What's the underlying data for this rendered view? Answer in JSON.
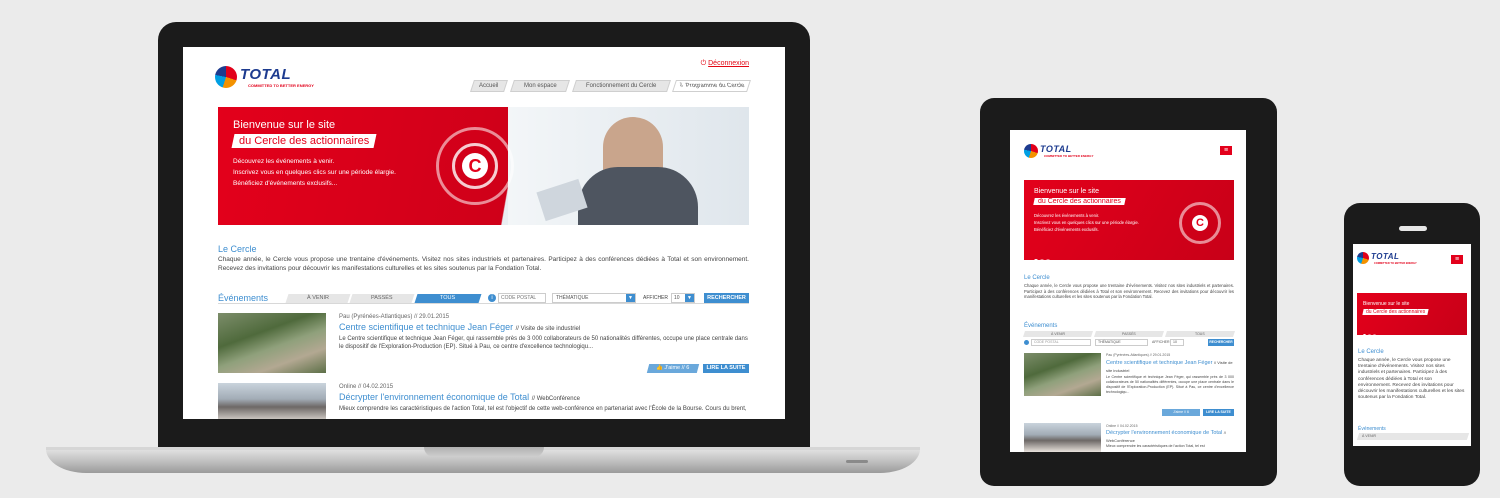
{
  "laptop": {
    "logout": "Déconnexion",
    "logo_word": "TOTAL",
    "logo_tag": "COMMITTED TO BETTER ENERGY",
    "nav": [
      {
        "label": "Accueil"
      },
      {
        "label": "Mon espace"
      },
      {
        "label": "Fonctionnement du Cercle"
      },
      {
        "label": "Programme du Cercle"
      }
    ],
    "banner": {
      "title1": "Bienvenue sur le site",
      "title2": "du Cercle des actionnaires",
      "line1": "Découvrez les événements à venir.",
      "line2": "Inscrivez vous en quelques clics sur une période élargie.",
      "line3": "Bénéficiez d'événements exclusifs..."
    },
    "intro": {
      "heading": "Le Cercle",
      "body": "Chaque année, le Cercle vous propose une trentaine d'événements. Visitez nos sites industriels et partenaires. Participez à des conférences dédiées à Total et son environnement. Recevez des invitations pour découvrir les manifestations culturelles et les sites soutenus par la Fondation Total."
    },
    "filters": {
      "heading": "Événements",
      "tabs": [
        "À VENIR",
        "PASSÉS",
        "TOUS"
      ],
      "postal_placeholder": "CODE POSTAL",
      "theme": "THÉMATIQUE",
      "show_label": "AFFICHER",
      "show_value": "10",
      "search": "RECHERCHER"
    },
    "events": [
      {
        "meta": "Pau (Pyrénées-Atlantiques) // 29.01.2015",
        "title": "Centre scientifique et technique Jean Féger",
        "type": "// Visite de site industriel",
        "desc": "Le Centre scientifique et technique Jean Féger, qui rassemble près de 3 000 collaborateurs de 50 nationalités différentes, occupe une place centrale dans le dispositif de l'Exploration-Production (EP). Situé à Pau, ce centre d'excellence technologiqu...",
        "likes": "J'aime // 6",
        "more": "LIRE LA SUITE"
      },
      {
        "meta": "Online // 04.02.2015",
        "title": "Décrypter l'environnement économique de Total",
        "type": "// WebConférence",
        "desc": "Mieux comprendre les caractéristiques de l'action Total, tel est l'objectif de cette web-conférence en partenariat avec l'École de la Bourse. Cours du brent,"
      }
    ]
  },
  "tablet": {
    "logo_word": "TOTAL",
    "logo_tag": "COMMITTED TO BETTER ENERGY",
    "banner": {
      "title1": "Bienvenue sur le site",
      "title2": "du Cercle des actionnaires",
      "line1": "Découvrez les événements à venir.",
      "line2": "Inscrivez vous en quelques clics sur une période élargie.",
      "line3": "Bénéficiez d'événements exclusifs."
    },
    "intro_heading": "Le Cercle",
    "intro_body": "Chaque année, le Cercle vous propose une trentaine d'événements. Visitez nos sites industriels et partenaires. Participez à des conférences dédiées à Total et son environnement. Recevez des invitations pour découvrir les manifestations culturelles et les sites soutenus par la Fondation Total.",
    "events_heading": "Événements",
    "tabs": [
      "À VENIR",
      "PASSÉS",
      "TOUS"
    ],
    "postal_placeholder": "CODE POSTAL",
    "theme": "THÉMATIQUE",
    "show_label": "AFFICHER",
    "show_value": "10",
    "search": "RECHERCHER",
    "event1_meta": "Pau (Pyrénées-Atlantiques) // 29.01.2015",
    "event1_title": "Centre scientifique et technique Jean Féger",
    "event1_type": "// Visite de site industriel",
    "event1_desc": "Le Centre scientifique et technique Jean Féger, qui rassemble près de 3 000 collaborateurs de 50 nationalités différentes, occupe une place centrale dans le dispositif de l'Exploration-Production (EP). Situé à Pau, ce centre d'excellence technologiqu...",
    "event1_likes": "J'aime // 6",
    "event1_more": "LIRE LA SUITE",
    "event2_meta": "Online // 04.02.2015",
    "event2_title": "Décrypter l'environnement économique de Total",
    "event2_type": "// WebConférence",
    "event2_desc": "Mieux comprendre les caractéristiques de l'action Total, tel est"
  },
  "phone": {
    "logo_word": "TOTAL",
    "logo_tag": "COMMITTED TO BETTER ENERGY",
    "banner_title1": "Bienvenue sur le site",
    "banner_title2": "du Cercle des actionnaires",
    "intro_heading": "Le Cercle",
    "intro_body": "Chaque année, le Cercle vous propose une trentaine d'événements. Visitez nos sites industriels et partenaires. Participez à des conférences dédiées à Total et son environnement. Recevez des invitations pour découvrir les manifestations culturelles et les sites soutenus par la Fondation Total.",
    "events_heading": "Événements",
    "tab": "À VENIR"
  },
  "colors": {
    "brand_red": "#e3001b",
    "accent_blue": "#3e8ed0",
    "logo_blue": "#1d3b8f"
  }
}
